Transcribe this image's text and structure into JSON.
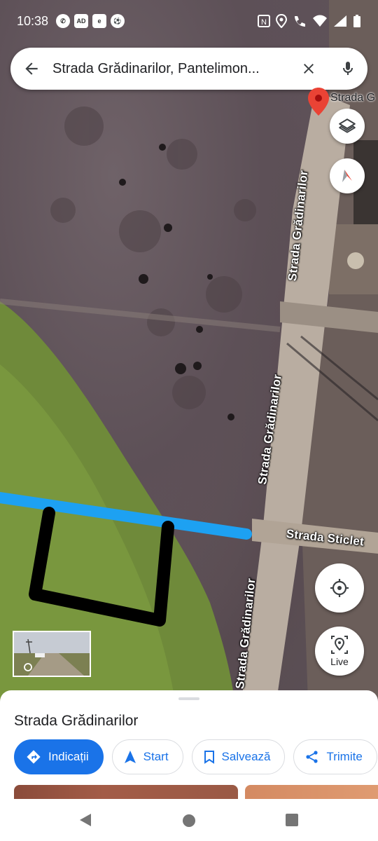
{
  "status_bar": {
    "time": "10:38",
    "left_icons": [
      "whatsapp-icon",
      "ad-icon",
      "emag-icon",
      "football-icon"
    ],
    "right_icons": [
      "nfc-icon",
      "location-icon",
      "wifi-calling-icon",
      "wifi-icon",
      "signal-4g-icon",
      "battery-icon"
    ]
  },
  "search": {
    "query": "Strada Grădinarilor, Pantelimon..."
  },
  "map": {
    "pin_label": "Strada G",
    "road_labels": {
      "road_upper": "Strada Grădinarilor",
      "road_middle": "Strada Grădinarilor",
      "road_lower": "Strada Grădinarilor",
      "cross_street": "Strada Sticlet"
    },
    "live_label": "Live",
    "route_color": "#1da1f2",
    "drawing_color": "#000000"
  },
  "sheet": {
    "title": "Strada Grădinarilor",
    "chips": {
      "directions": "Indicații",
      "start": "Start",
      "save": "Salvează",
      "share": "Trimite"
    },
    "accent_color": "#1a73e8"
  },
  "nav_bar": {
    "icons": [
      "back-triangle-icon",
      "home-circle-icon",
      "recents-square-icon"
    ]
  }
}
